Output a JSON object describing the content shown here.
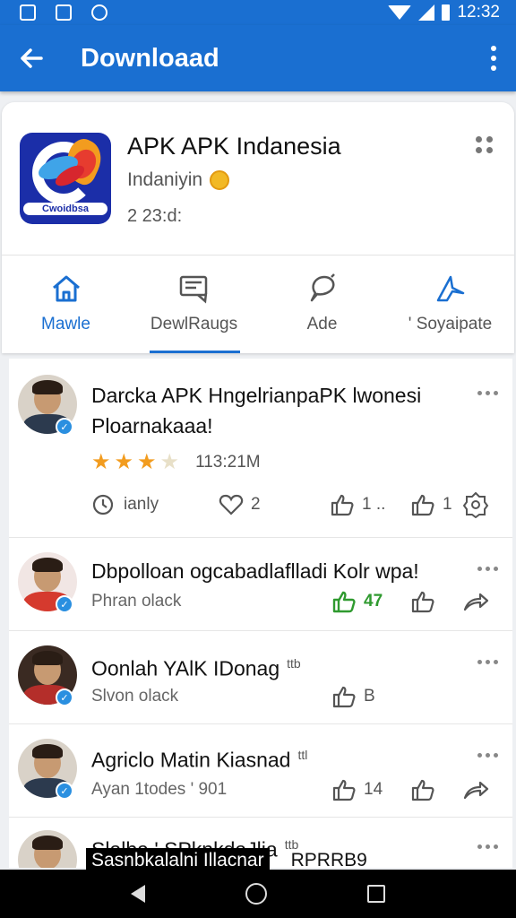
{
  "status_bar": {
    "time": "12:32"
  },
  "app_bar": {
    "title": "Downloaad"
  },
  "app": {
    "name": "APK APK Indanesia",
    "developer": "Indaniyin",
    "size": "2 23:d:",
    "icon_label": "Cwoidbsa"
  },
  "tabs": [
    {
      "label": "Mawle",
      "icon": "home-icon"
    },
    {
      "label": "DewlRaugs",
      "icon": "message-icon"
    },
    {
      "label": "Ade",
      "icon": "chat-bubble-icon"
    },
    {
      "label": "' Soyaipate",
      "icon": "plane-icon"
    }
  ],
  "posts": [
    {
      "title_line1": "Darcka APK HngelrianpaPK lwonesi",
      "title_line2": "Ploarnakaaa!",
      "rating": 3.5,
      "time": "113:21M",
      "actions": [
        "ianly",
        "2",
        "1 ..",
        "1"
      ]
    },
    {
      "title": "Dbpolloan ogcabadlaflladi Kolr wpa!",
      "subtitle": "Phran olack",
      "likes": "47"
    },
    {
      "title": "Oonlah YAlK IDonag",
      "tag": "ttb",
      "subtitle": "Slvon olack",
      "likes": "B"
    },
    {
      "title": "Agriclo Matin Kiasnad",
      "tag": "ttl",
      "subtitle": "Ayan 1todes ' 901",
      "likes": "14"
    },
    {
      "title": "Slalba ' SPknkdaJlia",
      "tag": "ttb"
    }
  ],
  "caption": {
    "text": "Sasnbkalalni Illacnar",
    "number": "RPRRB9"
  }
}
